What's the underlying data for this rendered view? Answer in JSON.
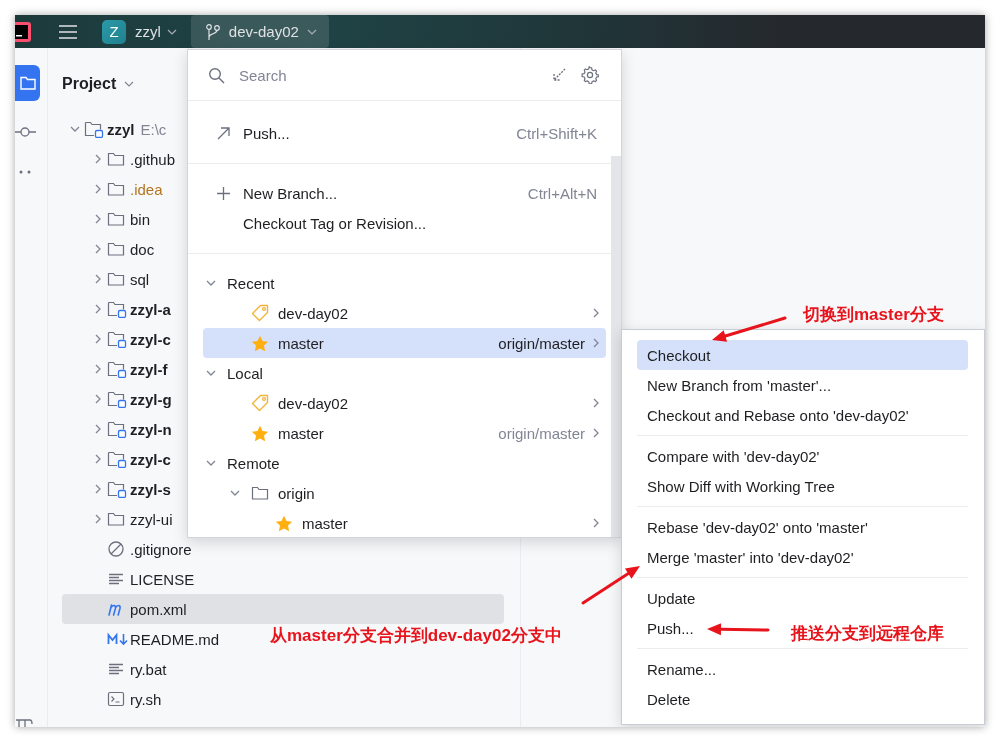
{
  "title_bar": {
    "project_badge": "Z",
    "project_name": "zzyl",
    "branch": "dev-day02"
  },
  "project_panel": {
    "title": "Project",
    "tree": [
      {
        "name": "zzyl",
        "path": "E:\\c",
        "kind": "module",
        "expanded": true,
        "selected": false,
        "children": [
          {
            "name": ".github",
            "kind": "folder",
            "expanded": false,
            "selected": false
          },
          {
            "name": ".idea",
            "kind": "ignored-folder",
            "expanded": false,
            "selected": false
          },
          {
            "name": "bin",
            "kind": "folder",
            "expanded": false,
            "selected": false
          },
          {
            "name": "doc",
            "kind": "folder",
            "expanded": false,
            "selected": false
          },
          {
            "name": "sql",
            "kind": "folder",
            "expanded": false,
            "selected": false
          },
          {
            "name": "zzyl-a",
            "kind": "module",
            "expanded": false,
            "selected": false
          },
          {
            "name": "zzyl-c",
            "kind": "module",
            "expanded": false,
            "selected": false
          },
          {
            "name": "zzyl-f",
            "kind": "module",
            "expanded": false,
            "selected": false
          },
          {
            "name": "zzyl-g",
            "kind": "module",
            "expanded": false,
            "selected": false
          },
          {
            "name": "zzyl-n",
            "kind": "module",
            "expanded": false,
            "selected": false
          },
          {
            "name": "zzyl-c",
            "kind": "module",
            "expanded": false,
            "selected": false
          },
          {
            "name": "zzyl-s",
            "kind": "module",
            "expanded": false,
            "selected": false
          },
          {
            "name": "zzyl-ui",
            "kind": "folder",
            "expanded": false,
            "selected": false
          },
          {
            "name": ".gitignore",
            "kind": "gitignore",
            "selected": false
          },
          {
            "name": "LICENSE",
            "kind": "text",
            "selected": false
          },
          {
            "name": "pom.xml",
            "kind": "maven",
            "selected": true
          },
          {
            "name": "README.md",
            "kind": "markdown",
            "selected": false
          },
          {
            "name": "ry.bat",
            "kind": "text",
            "selected": false
          },
          {
            "name": "ry.sh",
            "kind": "shell",
            "selected": false
          }
        ]
      }
    ]
  },
  "branch_popup": {
    "search": {
      "placeholder": "Search"
    },
    "action_groups": [
      [
        {
          "label": "Push...",
          "shortcut": "Ctrl+Shift+K",
          "kind": "push"
        }
      ],
      [
        {
          "label": "New Branch...",
          "shortcut": "Ctrl+Alt+N",
          "kind": "new"
        },
        {
          "label": "Checkout Tag or Revision...",
          "kind": "plain"
        }
      ]
    ],
    "branches": [
      {
        "label": "Recent",
        "kind": "group",
        "expanded": true,
        "selected": false,
        "children": [
          {
            "label": "dev-day02",
            "kind": "current",
            "selected": false
          },
          {
            "label": "master",
            "kind": "favorite",
            "tracking": "origin/master",
            "selected": true
          }
        ]
      },
      {
        "label": "Local",
        "kind": "group",
        "expanded": true,
        "selected": false,
        "children": [
          {
            "label": "dev-day02",
            "kind": "current",
            "selected": false
          },
          {
            "label": "master",
            "kind": "favorite",
            "tracking": "origin/master",
            "selected": false
          }
        ]
      },
      {
        "label": "Remote",
        "kind": "group",
        "expanded": true,
        "selected": false,
        "children": [
          {
            "label": "origin",
            "kind": "folder",
            "expanded": true,
            "selected": false,
            "children": [
              {
                "label": "master",
                "kind": "favorite",
                "selected": false
              }
            ]
          }
        ]
      }
    ]
  },
  "branch_menu": {
    "groups": [
      [
        {
          "label": "Checkout",
          "selected": true
        },
        {
          "label": "New Branch from 'master'...",
          "selected": false
        },
        {
          "label": "Checkout and Rebase onto 'dev-day02'",
          "selected": false
        }
      ],
      [
        {
          "label": "Compare with 'dev-day02'",
          "selected": false
        },
        {
          "label": "Show Diff with Working Tree",
          "selected": false
        }
      ],
      [
        {
          "label": "Rebase 'dev-day02' onto 'master'",
          "selected": false
        },
        {
          "label": "Merge 'master' into 'dev-day02'",
          "selected": false
        }
      ],
      [
        {
          "label": "Update",
          "selected": false
        },
        {
          "label": "Push...",
          "selected": false
        }
      ],
      [
        {
          "label": "Rename...",
          "selected": false
        },
        {
          "label": "Delete",
          "selected": false
        }
      ]
    ]
  },
  "annotations": [
    {
      "text": "切换到master分支"
    },
    {
      "text": "从master分支合并到dev-day02分支中"
    },
    {
      "text": "推送分支到远程仓库"
    }
  ]
}
